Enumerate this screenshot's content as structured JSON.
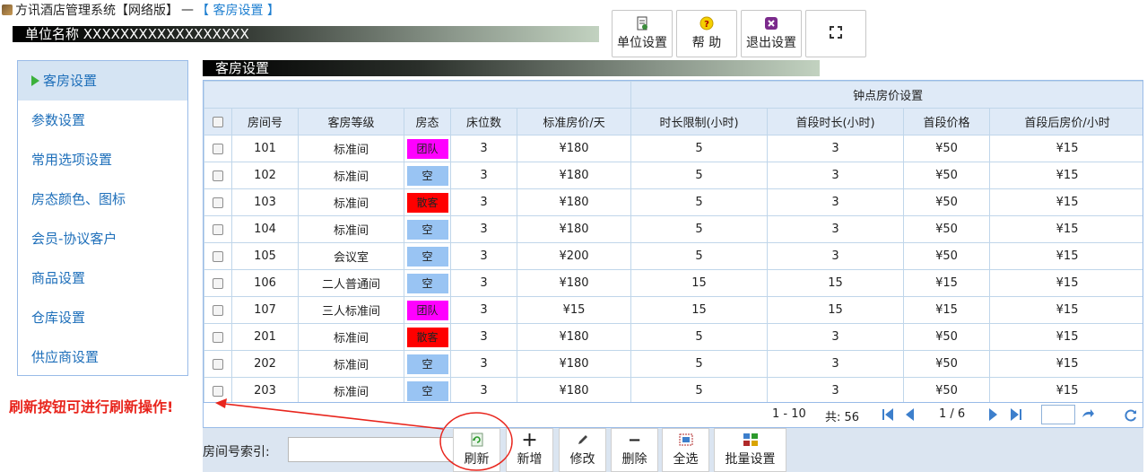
{
  "title": {
    "app_name": "方讯酒店管理系统【网络版】",
    "separator": "—",
    "current_page": "【 客房设置 】"
  },
  "unit_bar": {
    "label": "单位名称 XXXXXXXXXXXXXXXXXX"
  },
  "top_buttons": {
    "unit_settings": "单位设置",
    "help": "帮 助",
    "exit_settings": "退出设置"
  },
  "sidebar": {
    "items": [
      {
        "label": "客房设置",
        "active": true
      },
      {
        "label": "参数设置"
      },
      {
        "label": "常用选项设置"
      },
      {
        "label": "房态颜色、图标"
      },
      {
        "label": "会员-协议客户"
      },
      {
        "label": "商品设置"
      },
      {
        "label": "仓库设置"
      },
      {
        "label": "供应商设置"
      }
    ]
  },
  "section_title": "客房设置",
  "grid": {
    "group_header": "钟点房价设置",
    "columns": [
      "房间号",
      "客房等级",
      "房态",
      "床位数",
      "标准房价/天",
      "时长限制(小时)",
      "首段时长(小时)",
      "首段价格",
      "首段后房价/小时"
    ],
    "rows": [
      {
        "room": "101",
        "grade": "标准间",
        "status": "团队",
        "status_color": "#ff00ff",
        "beds": "3",
        "price": "¥180",
        "limit": "5",
        "first": "3",
        "first_price": "¥50",
        "after": "¥15"
      },
      {
        "room": "102",
        "grade": "标准间",
        "status": "空",
        "status_color": "#99c4f3",
        "beds": "3",
        "price": "¥180",
        "limit": "5",
        "first": "3",
        "first_price": "¥50",
        "after": "¥15"
      },
      {
        "room": "103",
        "grade": "标准间",
        "status": "散客",
        "status_color": "#ff0000",
        "beds": "3",
        "price": "¥180",
        "limit": "5",
        "first": "3",
        "first_price": "¥50",
        "after": "¥15"
      },
      {
        "room": "104",
        "grade": "标准间",
        "status": "空",
        "status_color": "#99c4f3",
        "beds": "3",
        "price": "¥180",
        "limit": "5",
        "first": "3",
        "first_price": "¥50",
        "after": "¥15"
      },
      {
        "room": "105",
        "grade": "会议室",
        "status": "空",
        "status_color": "#99c4f3",
        "beds": "3",
        "price": "¥200",
        "limit": "5",
        "first": "3",
        "first_price": "¥50",
        "after": "¥15"
      },
      {
        "room": "106",
        "grade": "二人普通间",
        "status": "空",
        "status_color": "#99c4f3",
        "beds": "3",
        "price": "¥180",
        "limit": "15",
        "first": "15",
        "first_price": "¥15",
        "after": "¥15"
      },
      {
        "room": "107",
        "grade": "三人标准间",
        "status": "团队",
        "status_color": "#ff00ff",
        "beds": "3",
        "price": "¥15",
        "limit": "15",
        "first": "15",
        "first_price": "¥15",
        "after": "¥15"
      },
      {
        "room": "201",
        "grade": "标准间",
        "status": "散客",
        "status_color": "#ff0000",
        "beds": "3",
        "price": "¥180",
        "limit": "5",
        "first": "3",
        "first_price": "¥50",
        "after": "¥15"
      },
      {
        "room": "202",
        "grade": "标准间",
        "status": "空",
        "status_color": "#99c4f3",
        "beds": "3",
        "price": "¥180",
        "limit": "5",
        "first": "3",
        "first_price": "¥50",
        "after": "¥15"
      },
      {
        "room": "203",
        "grade": "标准间",
        "status": "空",
        "status_color": "#99c4f3",
        "beds": "3",
        "price": "¥180",
        "limit": "5",
        "first": "3",
        "first_price": "¥50",
        "after": "¥15"
      }
    ]
  },
  "pager": {
    "range": "1 - 10",
    "total": "共: 56",
    "page": "1 / 6"
  },
  "toolbar": {
    "search_label": "房间号索引:",
    "refresh": "刷新",
    "add": "新增",
    "edit": "修改",
    "delete": "删除",
    "select_all": "全选",
    "batch": "批量设置"
  },
  "annotation": {
    "text": "刷新按钮可进行刷新操作!"
  }
}
